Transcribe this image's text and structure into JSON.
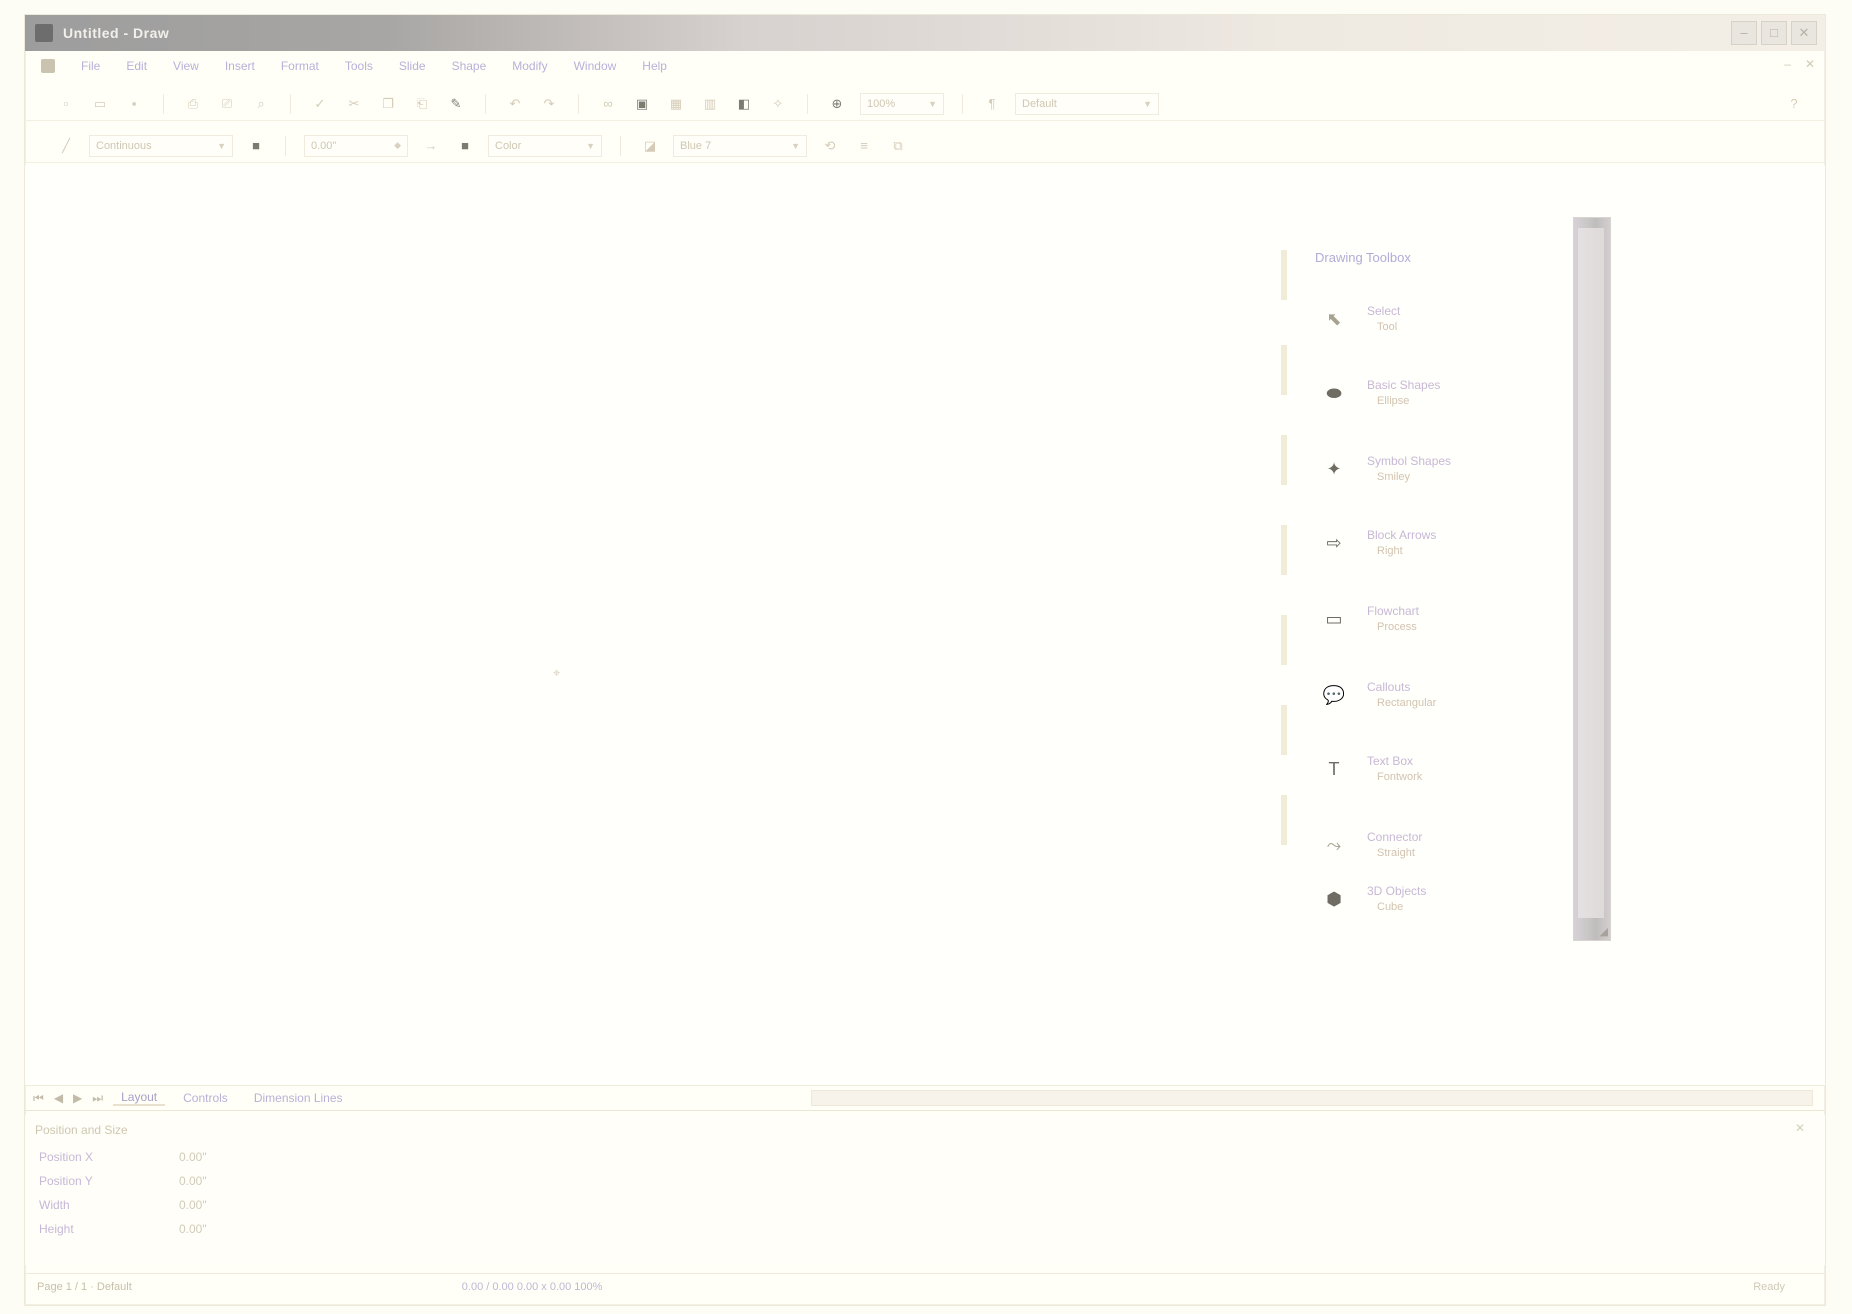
{
  "window": {
    "title": "Untitled - Draw"
  },
  "menus": [
    "File",
    "Edit",
    "View",
    "Insert",
    "Format",
    "Tools",
    "Slide",
    "Shape",
    "Modify",
    "Window",
    "Help"
  ],
  "toolbar_std": {
    "buttons": [
      "new",
      "open",
      "save",
      "export",
      "print",
      "preview",
      "spellcheck",
      "cut",
      "copy",
      "paste",
      "undo",
      "redo",
      "hyperlink",
      "insert-image",
      "table",
      "chart",
      "gallery",
      "navigator",
      "zoom"
    ],
    "zoom_value": "100%",
    "style_value": "Default"
  },
  "toolbar_fmt": {
    "line_style": "Continuous",
    "line_width": "0.00\"",
    "area_style": "Color",
    "area_color": "Blue 7"
  },
  "toolbox": {
    "title": "Drawing Toolbox",
    "items": [
      {
        "icon": "pointer-icon",
        "label": "Select",
        "sub": "Tool"
      },
      {
        "icon": "ellipse-icon",
        "label": "Basic Shapes",
        "sub": "Ellipse"
      },
      {
        "icon": "star-icon",
        "label": "Symbol Shapes",
        "sub": "Smiley"
      },
      {
        "icon": "arrow-icon",
        "label": "Block Arrows",
        "sub": "Right"
      },
      {
        "icon": "flowchart-icon",
        "label": "Flowchart",
        "sub": "Process"
      },
      {
        "icon": "callout-icon",
        "label": "Callouts",
        "sub": "Rectangular"
      },
      {
        "icon": "text-icon",
        "label": "Text Box",
        "sub": "Fontwork"
      },
      {
        "icon": "connector-icon",
        "label": "Connector",
        "sub": "Straight"
      },
      {
        "icon": "3d-icon",
        "label": "3D Objects",
        "sub": "Cube"
      }
    ]
  },
  "sheets": {
    "tabs": [
      "Layout",
      "Controls",
      "Dimension Lines"
    ],
    "active": 0
  },
  "panel": {
    "title": "Position and Size",
    "rows": [
      {
        "k": "Position X",
        "v": "0.00\""
      },
      {
        "k": "Position Y",
        "v": "0.00\""
      },
      {
        "k": "Width",
        "v": "0.00\""
      },
      {
        "k": "Height",
        "v": "0.00\""
      }
    ]
  },
  "status": {
    "left": "Page 1 / 1 · Default",
    "mid": "0.00 / 0.00    0.00 x 0.00    100%",
    "right": "Ready"
  }
}
